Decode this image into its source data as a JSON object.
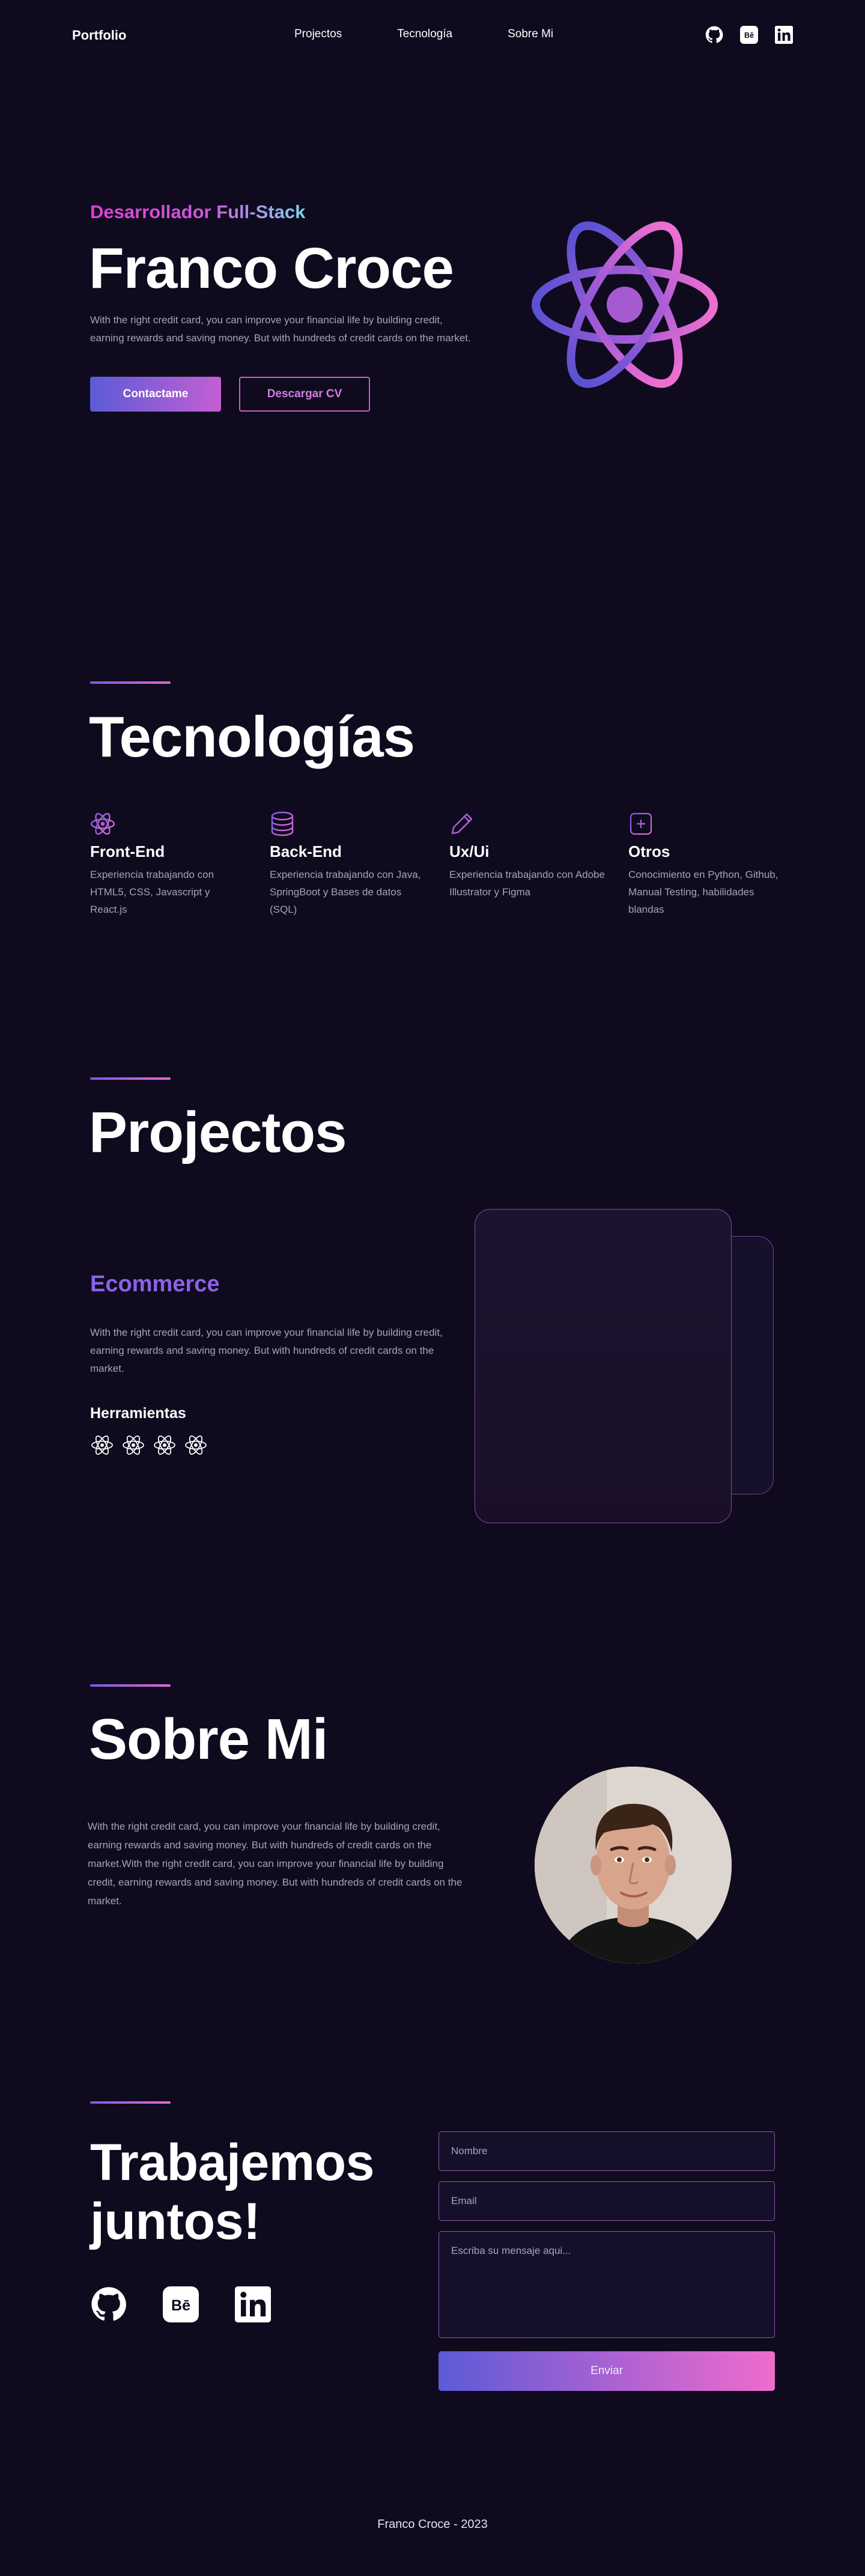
{
  "nav": {
    "logo": "Portfolio",
    "links": [
      "Projectos",
      "Tecnología",
      "Sobre Mi"
    ],
    "icons": [
      "github-icon",
      "behance-icon",
      "linkedin-icon"
    ]
  },
  "hero": {
    "subtitle": "Desarrollador Full-Stack",
    "title": "Franco Croce",
    "description": "With the right credit card, you can improve your financial life by building credit, earning rewards and saving money. But with hundreds of credit cards on the market.",
    "primary_button": "Contactame",
    "secondary_button": "Descargar CV",
    "illustration": "react-atom-icon"
  },
  "tech": {
    "title": "Tecnologías",
    "items": [
      {
        "icon": "atom-icon",
        "title": "Front-End",
        "desc": "Experiencia trabajando con HTML5, CSS, Javascript y React.js"
      },
      {
        "icon": "database-icon",
        "title": "Back-End",
        "desc": "Experiencia trabajando con Java, SpringBoot y Bases de datos (SQL)"
      },
      {
        "icon": "pencil-icon",
        "title": "Ux/Ui",
        "desc": "Experiencia trabajando con Adobe Illustrator y Figma"
      },
      {
        "icon": "plus-square-icon",
        "title": "Otros",
        "desc": "Conocimiento en Python, Github, Manual Testing, habilidades blandas"
      }
    ]
  },
  "projects": {
    "title": "Projectos",
    "item": {
      "name": "Ecommerce",
      "description": "With the right credit card, you can improve your financial life by building credit, earning rewards and saving money. But with hundreds of credit cards on the market.",
      "tools_label": "Herramientas",
      "tools": [
        "react-icon",
        "react-icon",
        "react-icon",
        "react-icon"
      ]
    }
  },
  "about": {
    "title": "Sobre Mi",
    "description": "With the right credit card, you can improve your financial life by building credit, earning rewards and saving money. But with hundreds of credit cards on the market.With the right credit card, you can improve your financial life by building credit, earning rewards and saving money. But with hundreds of credit cards on the market."
  },
  "contact": {
    "title_line1": "Trabajemos",
    "title_line2": "juntos!",
    "icons": [
      "github-icon",
      "behance-icon",
      "linkedin-icon"
    ],
    "name_placeholder": "Nombre",
    "email_placeholder": "Email",
    "message_placeholder": "Escriba su mensaje aqui...",
    "send_button": "Enviar"
  },
  "footer": {
    "text": "Franco Croce - 2023"
  },
  "colors": {
    "background": "#0f0a1e",
    "accent_purple": "#8a63e6",
    "accent_pink": "#e36ad0",
    "muted_text": "#a9a3b8"
  }
}
